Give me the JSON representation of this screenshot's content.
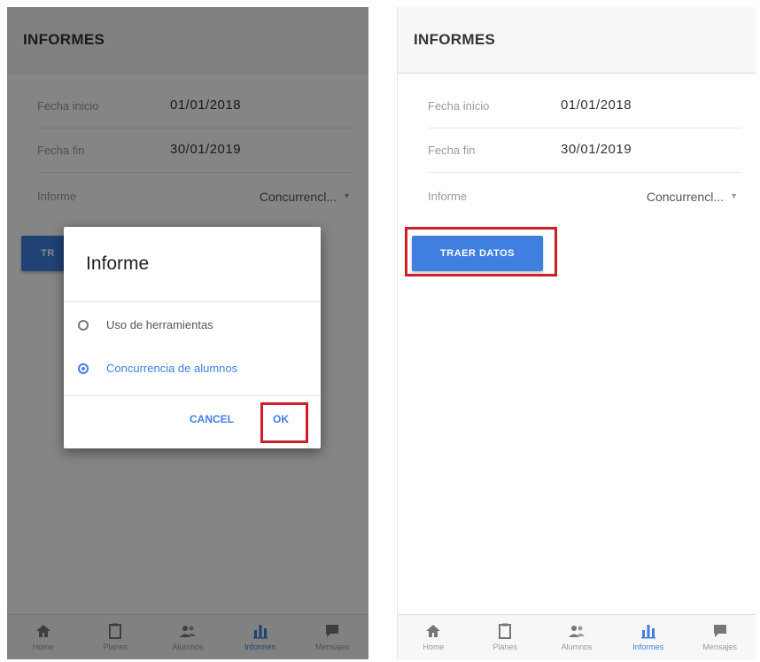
{
  "left": {
    "header": {
      "title": "INFORMES"
    },
    "fields": {
      "start_label": "Fecha inicio",
      "start_value": "01/01/2018",
      "end_label": "Fecha fin",
      "end_value": "30/01/2019",
      "report_label": "Informe",
      "report_value": "Concurrencl..."
    },
    "button_label": "TR",
    "dialog": {
      "title": "Informe",
      "options": [
        {
          "label": "Uso de herramientas",
          "checked": false
        },
        {
          "label": "Concurrencia de alumnos",
          "checked": true
        }
      ],
      "cancel_label": "CANCEL",
      "ok_label": "OK"
    }
  },
  "right": {
    "header": {
      "title": "INFORMES"
    },
    "fields": {
      "start_label": "Fecha inicio",
      "start_value": "01/01/2018",
      "end_label": "Fecha fin",
      "end_value": "30/01/2019",
      "report_label": "Informe",
      "report_value": "Concurrencl..."
    },
    "button_label": "TRAER DATOS"
  },
  "tabs": [
    {
      "label": "Home",
      "icon": "home-icon",
      "active": false
    },
    {
      "label": "Planes",
      "icon": "clipboard-icon",
      "active": false
    },
    {
      "label": "Alumnos",
      "icon": "people-icon",
      "active": false
    },
    {
      "label": "Informes",
      "icon": "bar-chart-icon",
      "active": true
    },
    {
      "label": "Mensajes",
      "icon": "chat-icon",
      "active": false
    }
  ],
  "colors": {
    "accent": "#3f7fe0",
    "highlight": "#d01d2a"
  }
}
